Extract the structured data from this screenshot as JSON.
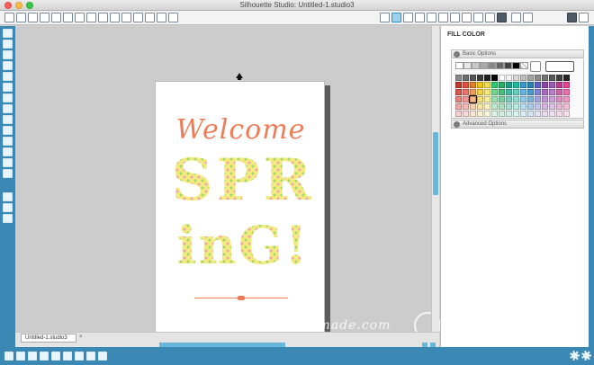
{
  "window": {
    "title": "Silhouette Studio: Untitled-1.studio3"
  },
  "design": {
    "welcome": "Welcome",
    "line1": "SPR",
    "line2": "inG!",
    "colors": {
      "orange": "#ee7d57",
      "yellow": "#f2ec7f",
      "pink": "#f4a6a8",
      "green": "#a8d66e"
    }
  },
  "watermark": {
    "text": "housefulofhandmade.com"
  },
  "doc_tab": {
    "label": "Untitled-1.studio3",
    "close": "×"
  },
  "panel": {
    "title": "FILL COLOR",
    "basic_options": "Basic Options",
    "advanced_options": "Advanced Options"
  },
  "icons": {
    "toolbar": [
      "new-document-icon",
      "open-icon",
      "save-icon",
      "print-icon",
      "cut-icon",
      "copy-icon",
      "paste-icon",
      "undo-icon",
      "redo-icon",
      "pan-icon",
      "zoom-in-icon",
      "zoom-out-icon",
      "zoom-fit-icon",
      "zoom-page-icon",
      "grid-icon"
    ],
    "toolbar_right": [
      "design-page-icon",
      "fill-color-icon",
      "line-color-icon",
      "text-icon",
      "align-icon",
      "replicate-icon",
      "offset-icon",
      "cut-settings-icon",
      "library-icon",
      "store-icon",
      "send-icon"
    ],
    "left": [
      "select-icon",
      "edit-points-icon",
      "line-icon",
      "rectangle-icon",
      "rounded-rect-icon",
      "ellipse-icon",
      "polygon-icon",
      "curve-icon",
      "arc-icon",
      "freehand-icon",
      "smooth-icon",
      "text-tool-icon",
      "eraser-icon",
      "knife-icon",
      "layers-icon",
      "library-panel-icon",
      "store-panel-icon"
    ],
    "bottom": [
      "group-icon",
      "ungroup-icon",
      "weld-icon",
      "bring-front-icon",
      "send-back-icon",
      "select-all-icon",
      "deselect-icon",
      "duplicate-icon",
      "delete-icon",
      "settings-gear-icon",
      "preferences-gear-icon"
    ]
  },
  "swatches": {
    "top": [
      "#ffffff",
      "#e8e8e8",
      "#c8c8c8",
      "#a8a8a8",
      "#888888",
      "#666666",
      "#444444",
      "#000000",
      "transparent"
    ],
    "grid": [
      [
        "#8a8a8a",
        "#6e6e6e",
        "#555555",
        "#3c3c3c",
        "#222222",
        "#000000",
        "#ffffff",
        "#f2f2f2",
        "#d9d9d9",
        "#bfbfbf",
        "#a6a6a6",
        "#8c8c8c",
        "#737373",
        "#595959",
        "#404040",
        "#262626"
      ],
      [
        "#c0392b",
        "#e74c3c",
        "#e67e22",
        "#f1c40f",
        "#f4e04d",
        "#2ecc71",
        "#27ae60",
        "#16a085",
        "#1abc9c",
        "#3498db",
        "#2980b9",
        "#5b5fc7",
        "#8e44ad",
        "#9b59b6",
        "#c0398b",
        "#e84393"
      ],
      [
        "#d9534f",
        "#f0716d",
        "#f39c5a",
        "#f5d142",
        "#f7ea77",
        "#6fd98f",
        "#4cbc7a",
        "#3fb8a4",
        "#5fd2bd",
        "#65b4e8",
        "#4b97cf",
        "#7e82d9",
        "#a768c4",
        "#b87ccb",
        "#d164a7",
        "#ef6fae"
      ],
      [
        "#e8807d",
        "#f4938f",
        "#f6b783",
        "#f8dc74",
        "#f9f09c",
        "#96e3ad",
        "#7fcf9e",
        "#76cbbd",
        "#8ddfcf",
        "#8fc9ee",
        "#7db3de",
        "#a2a5e4",
        "#c091d5",
        "#cba1da",
        "#de8ebf",
        "#f396c3"
      ],
      [
        "#f0a9a7",
        "#f8b8b5",
        "#f9cfab",
        "#fae6a3",
        "#fbf5c0",
        "#bdeccb",
        "#aee0c0",
        "#a9dcd4",
        "#b6ebe1",
        "#b7dcf4",
        "#abcdeb",
        "#c4c6ee",
        "#d6b7e3",
        "#dcc3e7",
        "#ebb6d5",
        "#f8bfd9"
      ],
      [
        "#f6d0cf",
        "#fbdad9",
        "#fce6d4",
        "#fdf1d1",
        "#fdf9df",
        "#ddf5e4",
        "#d5efdf",
        "#d3eee9",
        "#daf5ef",
        "#dbedf9",
        "#d4e5f5",
        "#e1e2f6",
        "#eadbf1",
        "#eee1f3",
        "#f5dbea",
        "#fbdfec"
      ]
    ]
  }
}
